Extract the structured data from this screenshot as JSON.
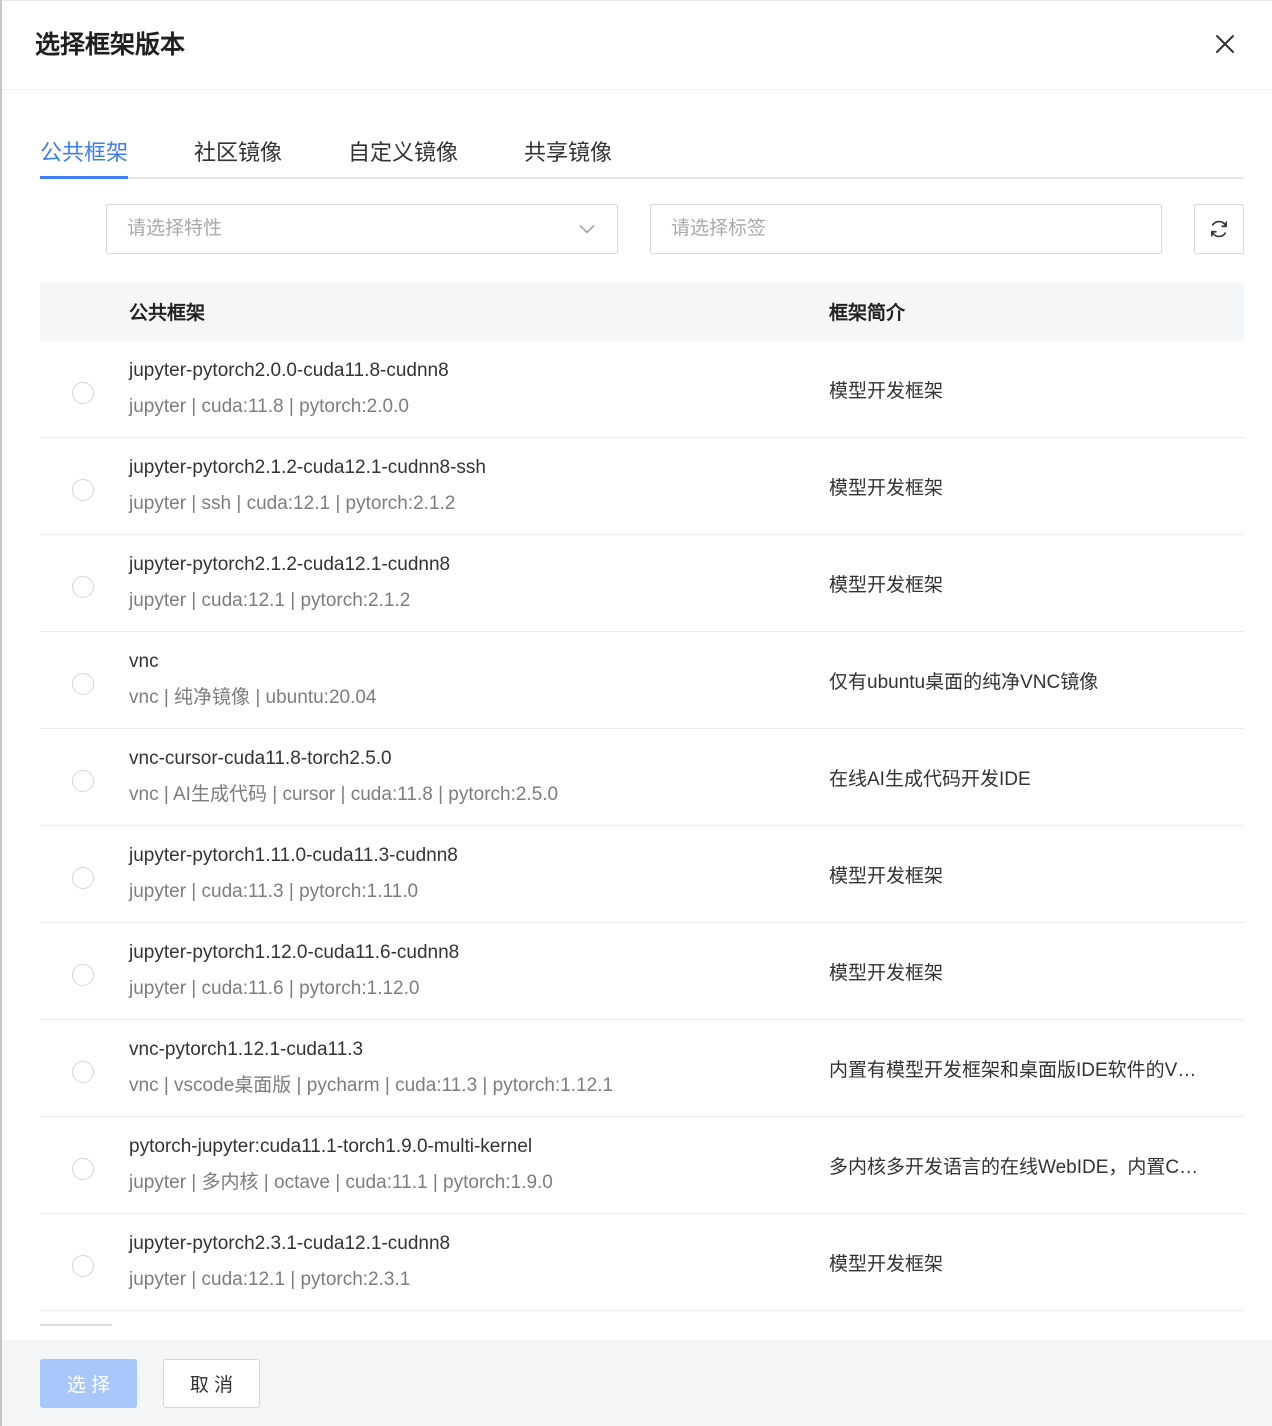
{
  "dialog": {
    "title": "选择框架版本"
  },
  "tabs": [
    {
      "label": "公共框架",
      "active": true
    },
    {
      "label": "社区镜像",
      "active": false
    },
    {
      "label": "自定义镜像",
      "active": false
    },
    {
      "label": "共享镜像",
      "active": false
    }
  ],
  "filters": {
    "feature_placeholder": "请选择特性",
    "tag_placeholder": "请选择标签"
  },
  "table": {
    "columns": {
      "name": "公共框架",
      "description": "框架简介"
    },
    "rows": [
      {
        "name": "jupyter-pytorch2.0.0-cuda11.8-cudnn8",
        "tags": "jupyter | cuda:11.8 | pytorch:2.0.0",
        "description": "模型开发框架",
        "selected": false
      },
      {
        "name": "jupyter-pytorch2.1.2-cuda12.1-cudnn8-ssh",
        "tags": "jupyter | ssh | cuda:12.1 | pytorch:2.1.2",
        "description": "模型开发框架",
        "selected": false
      },
      {
        "name": "jupyter-pytorch2.1.2-cuda12.1-cudnn8",
        "tags": "jupyter | cuda:12.1 | pytorch:2.1.2",
        "description": "模型开发框架",
        "selected": false
      },
      {
        "name": "vnc",
        "tags": "vnc | 纯净镜像 | ubuntu:20.04",
        "description": "仅有ubuntu桌面的纯净VNC镜像",
        "selected": false
      },
      {
        "name": "vnc-cursor-cuda11.8-torch2.5.0",
        "tags": "vnc | AI生成代码 | cursor | cuda:11.8 | pytorch:2.5.0",
        "description": "在线AI生成代码开发IDE",
        "selected": false
      },
      {
        "name": "jupyter-pytorch1.11.0-cuda11.3-cudnn8",
        "tags": "jupyter | cuda:11.3 | pytorch:1.11.0",
        "description": "模型开发框架",
        "selected": false
      },
      {
        "name": "jupyter-pytorch1.12.0-cuda11.6-cudnn8",
        "tags": "jupyter | cuda:11.6 | pytorch:1.12.0",
        "description": "模型开发框架",
        "selected": false
      },
      {
        "name": "vnc-pytorch1.12.1-cuda11.3",
        "tags": "vnc | vscode桌面版 | pycharm | cuda:11.3 | pytorch:1.12.1",
        "description": "内置有模型开发框架和桌面版IDE软件的V…",
        "selected": false
      },
      {
        "name": "pytorch-jupyter:cuda11.1-torch1.9.0-multi-kernel",
        "tags": "jupyter | 多内核 | octave | cuda:11.1 | pytorch:1.9.0",
        "description": "多内核多开发语言的在线WebIDE，内置C…",
        "selected": false
      },
      {
        "name": "jupyter-pytorch2.3.1-cuda12.1-cudnn8",
        "tags": "jupyter | cuda:12.1 | pytorch:2.3.1",
        "description": "模型开发框架",
        "selected": false
      }
    ]
  },
  "footer": {
    "confirm_label": "选 择",
    "confirm_disabled": true,
    "cancel_label": "取 消"
  },
  "icons": {
    "close": "close-icon",
    "feature_dropdown": "chevron-down-icon",
    "refresh": "refresh-icon"
  },
  "colors": {
    "accent": "#3d7ef6",
    "accent_disabled": "#a8c7fa",
    "header_background": "#f5f6f8",
    "footer_background": "#f4f5f7"
  }
}
